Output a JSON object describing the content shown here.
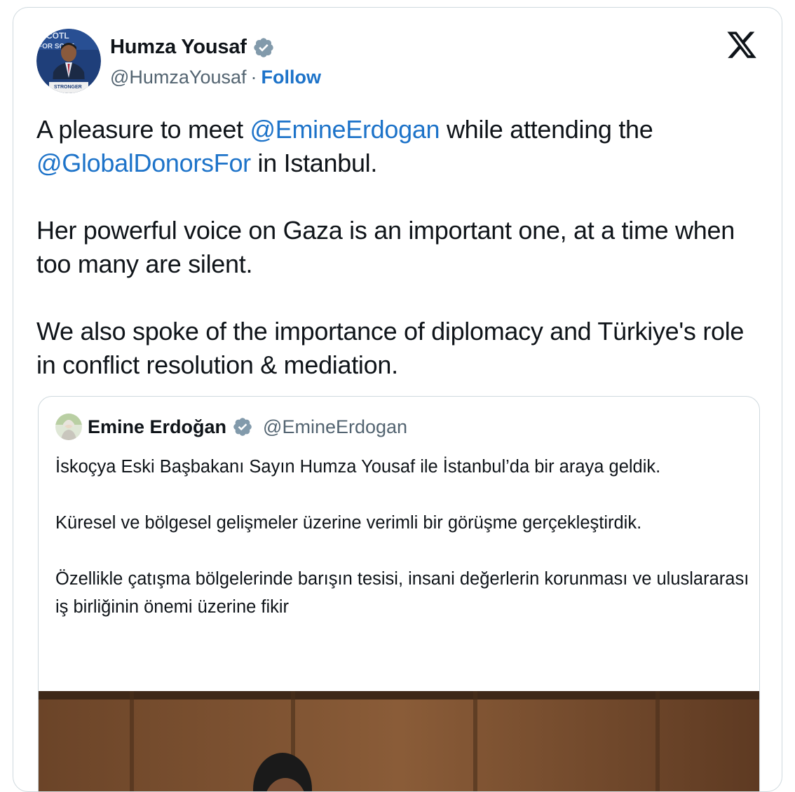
{
  "tweet": {
    "author": {
      "display_name": "Humza Yousaf",
      "handle": "@HumzaYousaf",
      "separator": "·",
      "follow_label": "Follow",
      "verified": true,
      "avatar_podium_text": "STRONGER"
    },
    "logo": "x-logo-icon",
    "text": {
      "p1_a": "A pleasure to meet ",
      "p1_mention1": "@EmineErdogan",
      "p1_b": " while attending the ",
      "p1_mention2": "@GlobalDonorsFor",
      "p1_c": " in Istanbul.",
      "p2": "Her powerful voice on Gaza is an important one, at a time when too many are silent.",
      "p3": "We also spoke of the importance of diplomacy and Türkiye's role in conflict resolution & mediation."
    }
  },
  "quoted": {
    "display_name": "Emine Erdoğan",
    "handle": "@EmineErdogan",
    "verified": true,
    "p1": "İskoçya Eski Başbakanı Sayın Humza Yousaf ile İstanbul’da bir araya geldik.",
    "p2": "Küresel ve bölgesel gelişmeler üzerine verimli bir görüşme gerçekleştirdik.",
    "p3": "Özellikle çatışma bölgelerinde barışın tesisi, insani değerlerin korunması ve uluslararası iş birliğinin önemi üzerine fikir"
  },
  "colors": {
    "link": "#1d73c9",
    "secondary_text": "#536471",
    "border": "#cfd9de",
    "verified_badge": "#829aab"
  }
}
